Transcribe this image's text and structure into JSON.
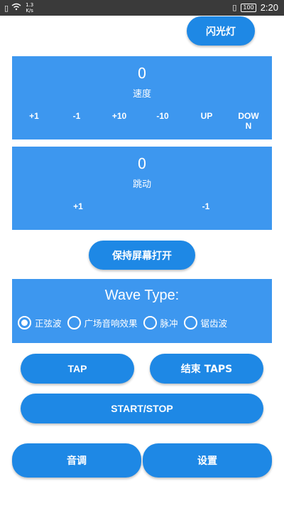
{
  "status_bar": {
    "speed_value": "1.3",
    "speed_unit": "K/s",
    "battery": "100",
    "time": "2:20"
  },
  "flashlight_label": "闪光灯",
  "speed_panel": {
    "value": "0",
    "label": "速度",
    "controls": [
      "+1",
      "-1",
      "+10",
      "-10",
      "UP",
      "DOW\nN"
    ]
  },
  "jump_panel": {
    "value": "0",
    "label": "跳动",
    "controls": [
      "+1",
      "-1"
    ]
  },
  "keep_screen_label": "保持屏幕打开",
  "wave": {
    "title": "Wave Type:",
    "selected_index": 0,
    "options": [
      "正弦波",
      "广场音响效果",
      "脉冲",
      "锯齿波"
    ]
  },
  "buttons": {
    "tap": "TAP",
    "end_taps": "结束 TAPS",
    "start_stop": "START/STOP",
    "tone": "音调",
    "settings": "设置"
  },
  "colors": {
    "button_blue": "#1e88e5",
    "panel_blue": "#3d97ef"
  }
}
